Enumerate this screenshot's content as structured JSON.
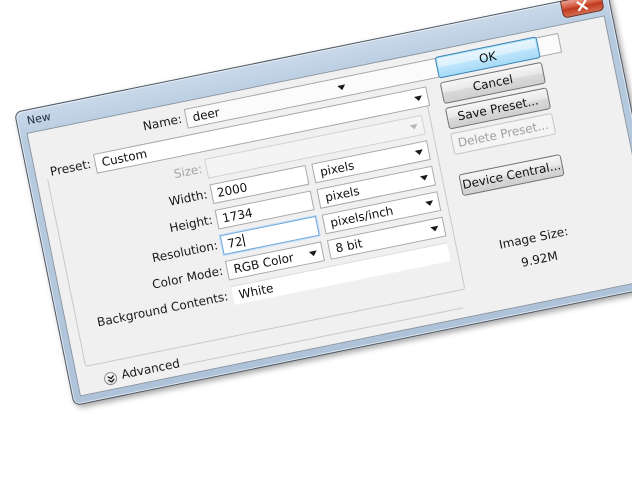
{
  "window": {
    "title": "New",
    "close_icon": "close-icon"
  },
  "form": {
    "name_label": "Name:",
    "name_value": "deer",
    "preset_label": "Preset:",
    "preset_value": "Custom",
    "size_label": "Size:",
    "size_value": "",
    "width_label": "Width:",
    "width_value": "2000",
    "width_unit": "pixels",
    "height_label": "Height:",
    "height_value": "1734",
    "height_unit": "pixels",
    "resolution_label": "Resolution:",
    "resolution_value": "72",
    "resolution_unit": "pixels/inch",
    "color_mode_label": "Color Mode:",
    "color_mode_value": "RGB Color",
    "bit_depth_value": "8 bit",
    "background_label": "Background Contents:",
    "background_value": "White",
    "advanced_label": "Advanced",
    "advanced_icon": "double-chevron-down-icon"
  },
  "buttons": {
    "ok": "OK",
    "cancel": "Cancel",
    "save_preset": "Save Preset...",
    "delete_preset": "Delete Preset...",
    "device_central": "Device Central..."
  },
  "info": {
    "image_size_label": "Image Size:",
    "image_size_value": "9.92M"
  },
  "colors": {
    "frame": "#b7cbe0",
    "client_bg": "#f0f0f0",
    "close_button": "#c8452a",
    "default_button": "#bee6fd"
  }
}
